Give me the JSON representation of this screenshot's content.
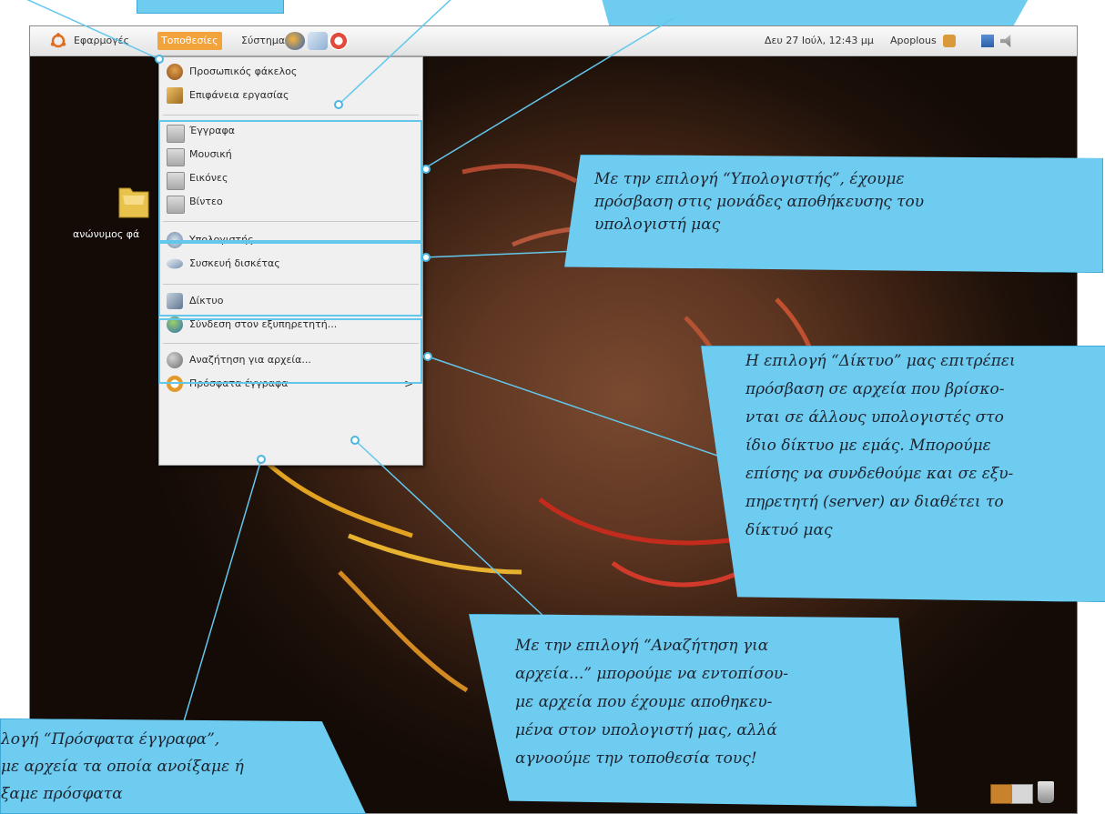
{
  "panel": {
    "applications": "Εφαρμογές",
    "places": "Τοποθεσίες",
    "system": "Σύστημα",
    "clock": "Δευ 27 Ιούλ, 12:43 μμ",
    "user": "Apoplous"
  },
  "places_menu": {
    "home": "Προσωπικός φάκελος",
    "desktop": "Επιφάνεια εργασίας",
    "documents": "Έγγραφα",
    "music": "Μουσική",
    "pictures": "Εικόνες",
    "videos": "Βίντεο",
    "computer": "Υπολογιστής",
    "floppy": "Συσκευή δισκέτας",
    "network": "Δίκτυο",
    "connect_server": "Σύνδεση στον εξυπηρετητή...",
    "search": "Αναζήτηση για αρχεία...",
    "recent": "Πρόσφατα έγγραφα",
    "submenu_arrow": ">"
  },
  "desktop": {
    "folder_label": "ανώνυμος φά"
  },
  "callouts": {
    "computer": [
      "Με την επιλογή “Υπολογιστής”, έχουμε",
      "πρόσβαση στις μονάδες αποθήκευσης του",
      "υπολογιστή μας"
    ],
    "network": [
      "Η επιλογή “Δίκτυο” μας επιτρέπει",
      "πρόσβαση σε αρχεία που βρίσκο-",
      "νται σε άλλους υπολογιστές στο",
      "ίδιο δίκτυο με εμάς. Μπορούμε",
      "επίσης να συνδεθούμε και σε εξυ-",
      "πηρετητή (server) αν διαθέτει το",
      "δίκτυό μας"
    ],
    "search": [
      "Με την επιλογή “Αναζήτηση για",
      "αρχεία...” μπορούμε να εντοπίσου-",
      "με αρχεία που έχουμε αποθηκευ-",
      "μένα στον υπολογιστή μας, αλλά",
      "αγνοούμε την τοποθεσία τους!"
    ],
    "recent": [
      "λογή “Πρόσφατα έγγραφα”,",
      "με αρχεία τα οποία ανοίξαμε ή",
      "ξαμε πρόσφατα"
    ]
  },
  "colors": {
    "callout": "#6dccf0",
    "menu_highlight": "#f2a33b"
  }
}
